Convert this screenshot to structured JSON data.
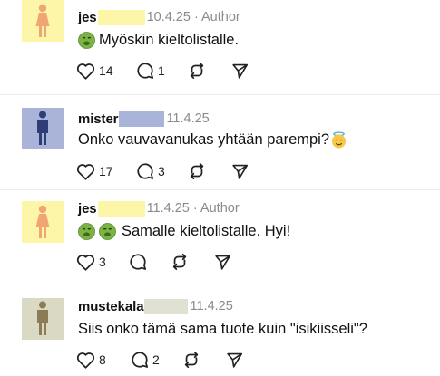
{
  "comments": [
    {
      "username": "jes",
      "date": "10.4.25",
      "author_label": "· Author",
      "text": "Myöskin kieltolistalle.",
      "likes": "14",
      "replies": "1",
      "avatar_icon": "female-person-icon",
      "avatar_bg": "#fdf6a8",
      "redact_color": "#fdf6a8"
    },
    {
      "username": "mister",
      "date": "11.4.25",
      "author_label": "",
      "text": "Onko vauvavanukas yhtään parempi?",
      "likes": "17",
      "replies": "3",
      "avatar_icon": "male-person-icon",
      "avatar_bg": "#aab4d8",
      "redact_color": "#aab4d8"
    },
    {
      "username": "jes",
      "date": "11.4.25",
      "author_label": "· Author",
      "text": "Samalle kieltolistalle. Hyi!",
      "likes": "3",
      "replies": "",
      "avatar_icon": "female-person-icon",
      "avatar_bg": "#fdf6a8",
      "redact_color": "#fdf6a8"
    },
    {
      "username": "mustekala",
      "date": "11.4.25",
      "author_label": "",
      "text": "Siis onko tämä sama tuote kuin \"isikiisseli\"?",
      "likes": "8",
      "replies": "2",
      "avatar_icon": "person-icon",
      "avatar_bg": "#d9d9c4",
      "redact_color": "#e1e1d3"
    }
  ],
  "icons": {
    "like": "heart-icon",
    "reply": "comment-bubble-icon",
    "repost": "repost-icon",
    "share": "send-icon",
    "nauseated": "nauseated-face-emoji",
    "halo": "smiling-face-with-halo-emoji"
  }
}
